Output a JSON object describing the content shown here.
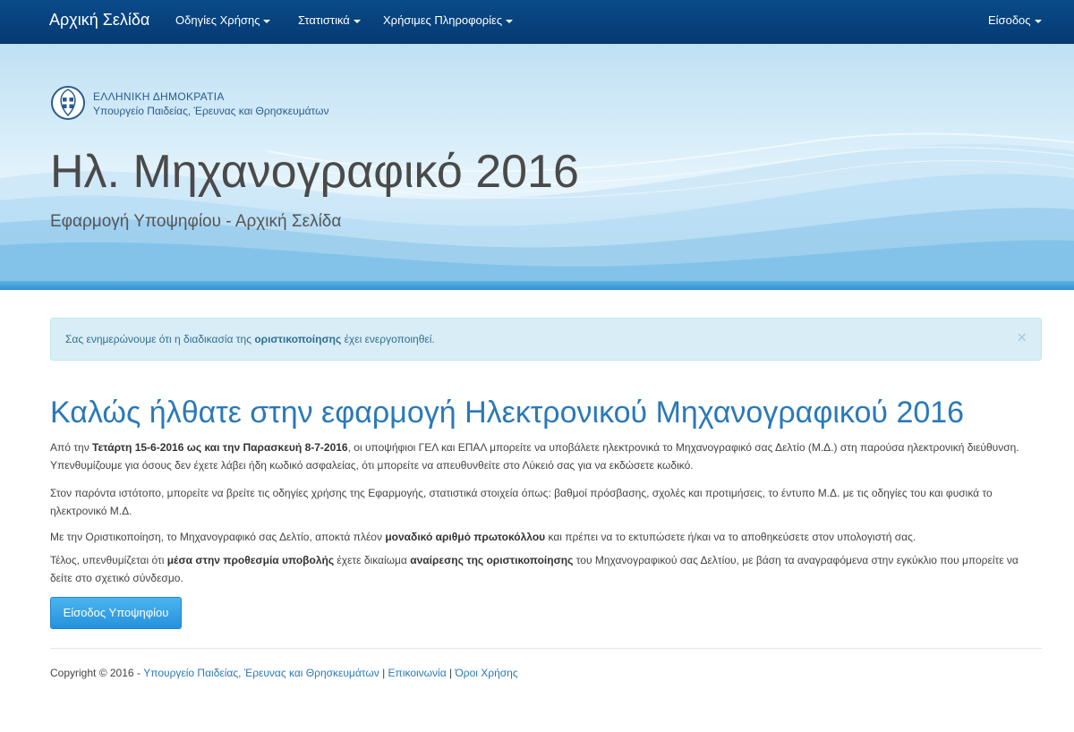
{
  "navbar": {
    "brand": "Αρχική Σελίδα",
    "items": [
      {
        "label": "Οδηγίες Χρήσης"
      },
      {
        "label": "Στατιστικά"
      },
      {
        "label": "Χρήσιμες Πληροφορίες"
      }
    ],
    "login": "Είσοδος"
  },
  "header": {
    "gov_line1": "ΕΛΛΗΝΙΚΗ ΔΗΜΟΚΡΑΤΙΑ",
    "gov_line2": "Υπουργείο Παιδείας, Έρευνας και Θρησκευμάτων",
    "title": "Ηλ. Μηχανογραφικό 2016",
    "subtitle": "Εφαρμογή Υποψηφίου - Αρχική Σελίδα"
  },
  "alert": {
    "pre": "Σας ενημερώνουμε ότι η διαδικασία της ",
    "bold": "οριστικοποίησης",
    "post": " έχει ενεργοποιηθεί.",
    "close": "×"
  },
  "main": {
    "heading": "Καλώς ήλθατε στην εφαρμογή Ηλεκτρονικού Μηχανογραφικού 2016",
    "p1": {
      "a": "Από την ",
      "b": "Τετάρτη 15-6-2016 ως και την Παρασκευή 8-7-2016",
      "c": ", οι υποψήφιοι ΓΕΛ και ΕΠΑΛ μπορείτε να υποβάλετε ηλεκτρονικά το Μηχανογραφικό σας Δελτίο (Μ.Δ.) στη παρούσα ηλεκτρονική διεύθυνση. Υπενθυμίζουμε για όσους δεν έχετε λάβει ήδη κωδικό ασφαλείας, ότι μπορείτε να απευθυνθείτε στο Λύκειό σας για να εκδώσετε κωδικό."
    },
    "p2": "Στον παρόντα ιστότοπο, μπορείτε να βρείτε τις οδηγίες χρήσης της Εφαρμογής, στατιστικά στοιχεία όπως: βαθμοί πρόσβασης, σχολές και προτιμήσεις, το έντυπο Μ.Δ. με τις οδηγίες του και φυσικά το ηλεκτρονικό Μ.Δ.",
    "p3": {
      "a": "Με την Οριστικοποίηση, το Μηχανογραφικό σας Δελτίο, αποκτά πλέον ",
      "b": "μοναδικό αριθμό πρωτοκόλλου",
      "c": " και πρέπει να το εκτυπώσετε ή/και να το αποθηκεύσετε στον υπολογιστή σας."
    },
    "p4": {
      "a": "Τέλος, υπενθυμίζεται ότι ",
      "b": "μέσα στην προθεσμία υποβολής",
      "c": " έχετε δικαίωμα ",
      "d": "αναίρεσης της οριστικοποίησης",
      "e": " του Μηχανογραφικού σας Δελτίου, με βάση τα αναγραφόμενα στην εγκύκλιο που μπορείτε να δείτε στο σχετικό σύνδεσμο."
    },
    "button": "Είσοδος Υποψηφίου"
  },
  "footer": {
    "copyright": "Copyright © 2016 - ",
    "ministry": "Υπουργείο Παιδείας, Έρευνας και Θρησκευμάτων",
    "sep": " | ",
    "contact": "Επικοινωνία",
    "terms": "Όροι Χρήσης"
  },
  "colors": {
    "navbar": "#053a72",
    "link": "#2a79b8",
    "alert_bg": "#d9edf7",
    "button": "#2592dc"
  },
  "icons": {
    "emblem": "greek-emblem-icon",
    "caret": "caret-down-icon",
    "close": "close-icon"
  }
}
